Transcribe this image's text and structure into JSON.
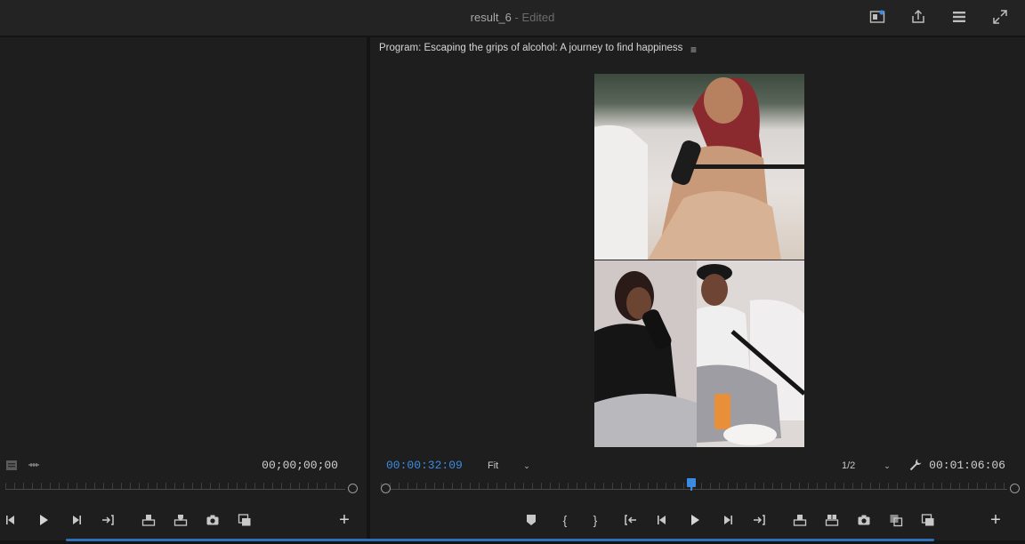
{
  "window": {
    "title": "result_6",
    "separator": " - ",
    "status": "Edited",
    "icons": [
      "workspace-icon",
      "export-icon",
      "menu-icon",
      "fullscreen-icon"
    ]
  },
  "program": {
    "title": "Program: Escaping the grips of alcohol: A journey to find happiness",
    "menu_glyph": "≡",
    "current_timecode": "00:00:32:09",
    "zoom_label": "Fit",
    "resolution_label": "1/2",
    "duration_timecode": "00:01:06:06",
    "playhead_fraction": 0.49
  },
  "source": {
    "timecode": "00;00;00;00"
  },
  "colors": {
    "accent": "#3b8be3",
    "panel_bg": "#1e1e1e",
    "titlebar_bg": "#232323"
  },
  "icons": {
    "plus": "+",
    "in_bracket": "{",
    "out_bracket": "}"
  }
}
